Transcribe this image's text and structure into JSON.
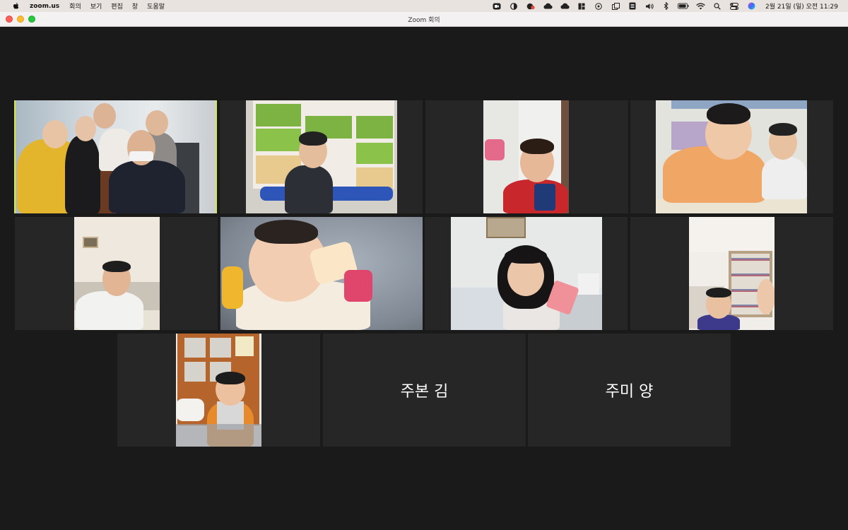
{
  "menubar": {
    "apple_icon": "apple-logo-icon",
    "app_name": "zoom.us",
    "menus": [
      "회의",
      "보기",
      "편집",
      "창",
      "도움말"
    ],
    "status_icons": [
      "zoom-icon",
      "contrast-icon",
      "notification-icon",
      "cloud-icon",
      "cloud-filled-icon",
      "grid-icon",
      "play-icon",
      "window-icon",
      "text-icon",
      "volume-icon",
      "bluetooth-icon",
      "battery-icon",
      "wifi-icon",
      "search-icon",
      "control-center-icon",
      "siri-icon"
    ],
    "clock": "2월 21일 (일) 오전 11:29"
  },
  "window": {
    "title": "Zoom 회의"
  },
  "participants": [
    {
      "row": 1,
      "col": 1,
      "name": "",
      "has_video": true,
      "active_speaker": true
    },
    {
      "row": 1,
      "col": 2,
      "name": "",
      "has_video": true
    },
    {
      "row": 1,
      "col": 3,
      "name": "",
      "has_video": true
    },
    {
      "row": 1,
      "col": 4,
      "name": "",
      "has_video": true
    },
    {
      "row": 2,
      "col": 1,
      "name": "",
      "has_video": true
    },
    {
      "row": 2,
      "col": 2,
      "name": "",
      "has_video": true
    },
    {
      "row": 2,
      "col": 3,
      "name": "",
      "has_video": true
    },
    {
      "row": 2,
      "col": 4,
      "name": "",
      "has_video": true
    },
    {
      "row": 3,
      "col": 1,
      "name": "",
      "has_video": true
    },
    {
      "row": 3,
      "col": 2,
      "name": "주본 김",
      "has_video": false
    },
    {
      "row": 3,
      "col": 3,
      "name": "주미 양",
      "has_video": false
    }
  ],
  "colors": {
    "active_speaker_border": "#d7e84a",
    "tile_background": "#262626",
    "stage_background": "#1a1a1a"
  }
}
